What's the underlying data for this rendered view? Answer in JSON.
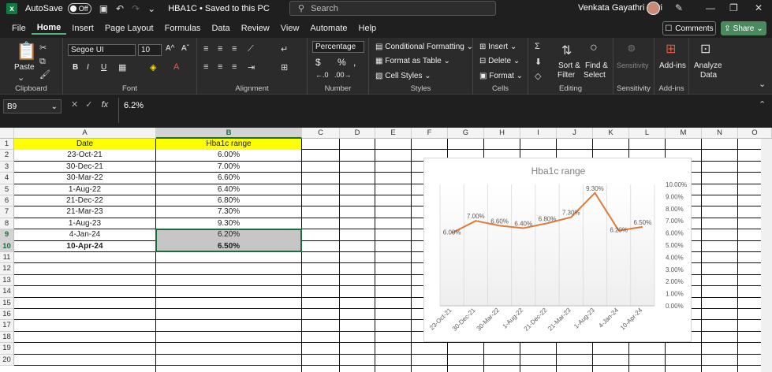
{
  "titlebar": {
    "autosave_label": "AutoSave",
    "autosave_state": "Off",
    "doc_title": "HBA1C • Saved to this PC",
    "search_placeholder": "Search",
    "user_name": "Venkata Gayathri Peri"
  },
  "menu": {
    "items": [
      "File",
      "Home",
      "Insert",
      "Page Layout",
      "Formulas",
      "Data",
      "Review",
      "View",
      "Automate",
      "Help"
    ],
    "active": "Home",
    "comments_label": "Comments",
    "share_label": "Share"
  },
  "ribbon": {
    "clipboard": {
      "paste_label": "Paste",
      "group_label": "Clipboard"
    },
    "font": {
      "font_name": "Segoe UI",
      "font_size": "10",
      "group_label": "Font",
      "bold": "B",
      "italic": "I",
      "underline": "U"
    },
    "alignment": {
      "group_label": "Alignment"
    },
    "number": {
      "format": "Percentage",
      "group_label": "Number"
    },
    "styles": {
      "conditional": "Conditional Formatting",
      "format_table": "Format as Table",
      "cell_styles": "Cell Styles",
      "group_label": "Styles"
    },
    "cells": {
      "insert": "Insert",
      "delete": "Delete",
      "format": "Format",
      "group_label": "Cells"
    },
    "editing": {
      "sort_filter_1": "Sort &",
      "sort_filter_2": "Filter",
      "find_select_1": "Find &",
      "find_select_2": "Select",
      "group_label": "Editing"
    },
    "sensitivity": {
      "label": "Sensitivity",
      "group_label": "Sensitivity"
    },
    "addins": {
      "label": "Add-ins",
      "group_label": "Add-ins"
    },
    "analyze": {
      "label_1": "Analyze",
      "label_2": "Data"
    }
  },
  "formula_bar": {
    "name_box": "B9",
    "fx": "fx",
    "value": "6.2%"
  },
  "sheet": {
    "columns": [
      "A",
      "B",
      "C",
      "D",
      "E",
      "F",
      "G",
      "H",
      "I",
      "J",
      "K",
      "L",
      "M",
      "N",
      "O"
    ],
    "rows": [
      "1",
      "2",
      "3",
      "4",
      "5",
      "6",
      "7",
      "8",
      "9",
      "10",
      "11",
      "12",
      "13",
      "14",
      "15",
      "16",
      "17",
      "18",
      "19",
      "20"
    ],
    "header_date": "Date",
    "header_range": "Hba1c range",
    "data": [
      {
        "date": "23-Oct-21",
        "value": "6.00%"
      },
      {
        "date": "30-Dec-21",
        "value": "7.00%"
      },
      {
        "date": "30-Mar-22",
        "value": "6.60%"
      },
      {
        "date": "1-Aug-22",
        "value": "6.40%"
      },
      {
        "date": "21-Dec-22",
        "value": "6.80%"
      },
      {
        "date": "21-Mar-23",
        "value": "7.30%"
      },
      {
        "date": "1-Aug-23",
        "value": "9.30%"
      },
      {
        "date": "4-Jan-24",
        "value": "6.20%"
      },
      {
        "date": "10-Apr-24",
        "value": "6.50%"
      }
    ]
  },
  "chart_data": {
    "type": "line",
    "title": "Hba1c range",
    "categories": [
      "23-Oct-21",
      "30-Dec-21",
      "30-Mar-22",
      "1-Aug-22",
      "21-Dec-22",
      "21-Mar-23",
      "1-Aug-23",
      "4-Jan-24",
      "10-Apr-24"
    ],
    "values": [
      6.0,
      7.0,
      6.6,
      6.4,
      6.8,
      7.3,
      9.3,
      6.2,
      6.5
    ],
    "data_labels": [
      "6.00%",
      "7.00%",
      "6.60%",
      "6.40%",
      "6.80%",
      "7.30%",
      "9.30%",
      "6.20%",
      "6.50%"
    ],
    "y_ticks": [
      "0.00%",
      "1.00%",
      "2.00%",
      "3.00%",
      "4.00%",
      "5.00%",
      "6.00%",
      "7.00%",
      "8.00%",
      "9.00%",
      "10.00%"
    ],
    "ylim": [
      0,
      10
    ],
    "y_axis_side": "right",
    "line_color": "#e07b39",
    "grid": "vertical"
  }
}
